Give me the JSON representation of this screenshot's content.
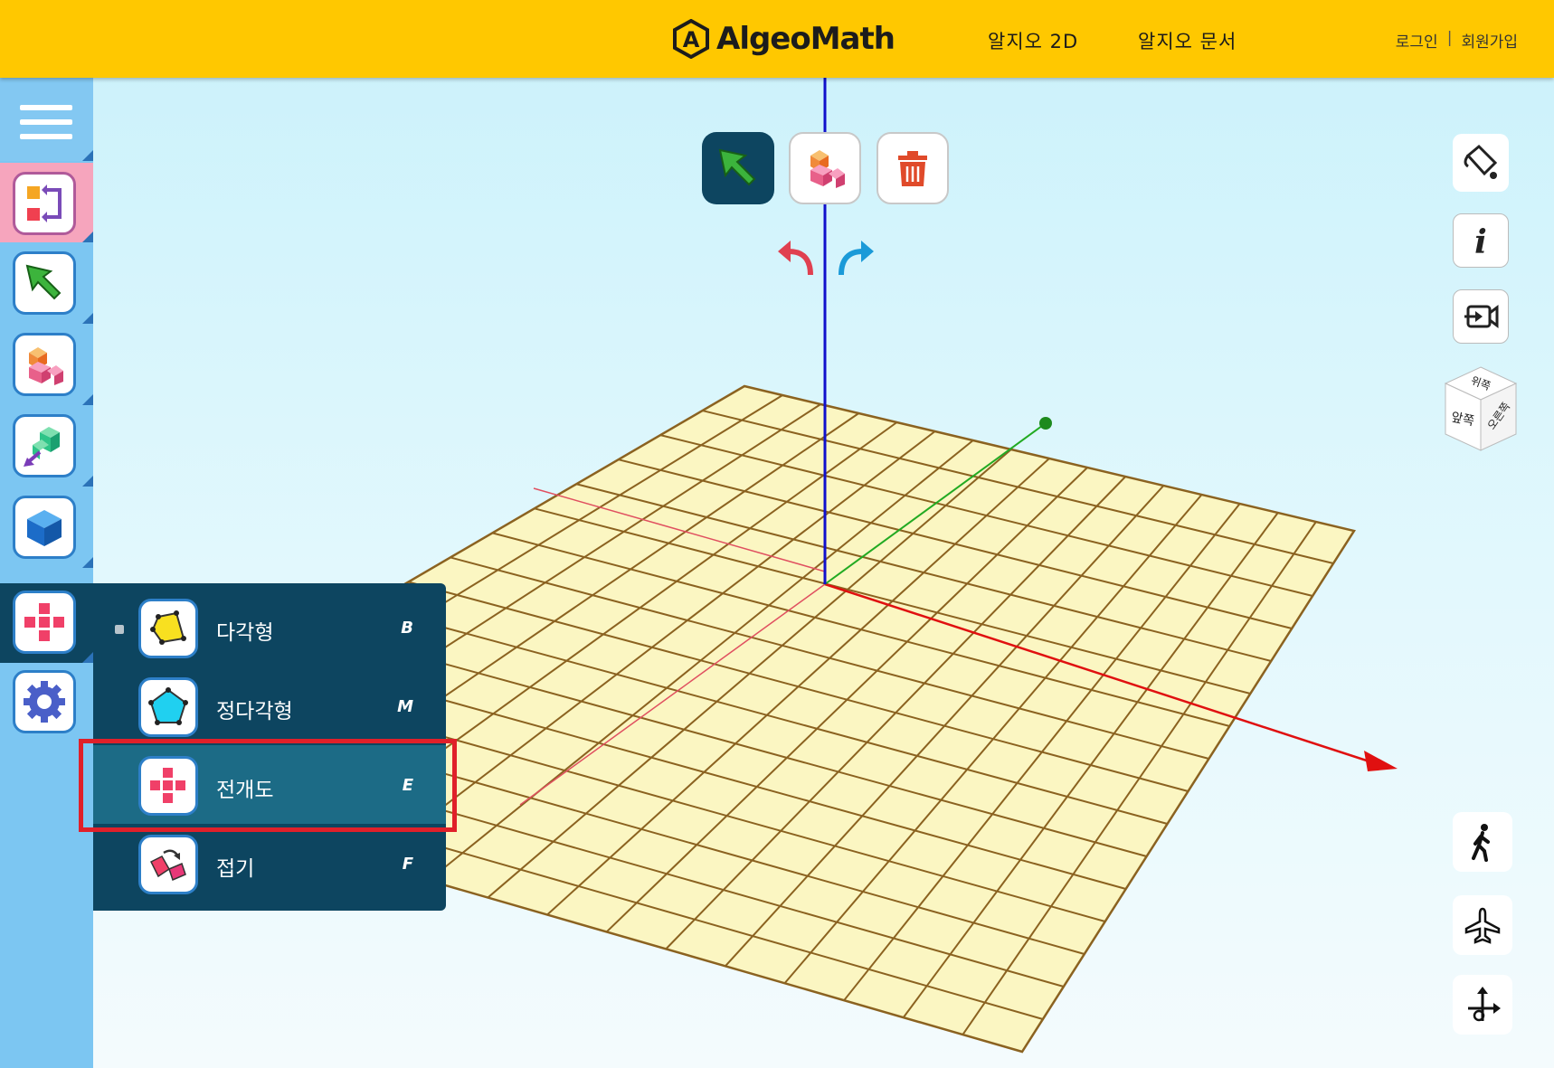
{
  "header": {
    "logo_text": "AlgeoMath",
    "nav": [
      "알지오 2D",
      "알지오 문서"
    ],
    "auth": {
      "login": "로그인",
      "separator": "|",
      "signup": "회원가입"
    }
  },
  "flyout": {
    "items": [
      {
        "label": "다각형",
        "key": "B",
        "icon": "polygon-icon",
        "selected_dot": true
      },
      {
        "label": "정다각형",
        "key": "M",
        "icon": "regular-polygon-icon",
        "selected_dot": false
      },
      {
        "label": "전개도",
        "key": "E",
        "icon": "net-icon",
        "selected_dot": false
      },
      {
        "label": "접기",
        "key": "F",
        "icon": "fold-icon",
        "selected_dot": false
      }
    ]
  },
  "viewcube": {
    "top": "위쪽",
    "front": "앞쪽",
    "right": "오른쪽"
  },
  "colors": {
    "topbar": "#ffc800",
    "sidebar": "#7cc6f2",
    "flyout": "#0d4560",
    "flyout_active": "#1c6b86",
    "highlight": "#e0202a",
    "grid_fill": "#fbf6c2",
    "grid_line": "#8b6220"
  }
}
